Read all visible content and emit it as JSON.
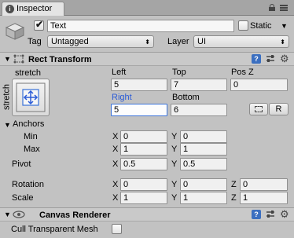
{
  "tab": {
    "label": "Inspector",
    "icon": "info-icon"
  },
  "object": {
    "name": "Text",
    "active": true,
    "static_label": "Static",
    "static_checked": false,
    "tag_label": "Tag",
    "tag_value": "Untagged",
    "layer_label": "Layer",
    "layer_value": "UI"
  },
  "rect_transform": {
    "title": "Rect Transform",
    "anchor_preset_label": "stretch",
    "anchor_preset_side_label": "stretch",
    "headers": {
      "left": "Left",
      "top": "Top",
      "posz": "Pos Z",
      "right": "Right",
      "bottom": "Bottom"
    },
    "values": {
      "left": "5",
      "top": "7",
      "posz": "0",
      "right": "5",
      "bottom": "6"
    },
    "blueprint_button": "",
    "raw_button": "R",
    "anchors_label": "Anchors",
    "min_label": "Min",
    "max_label": "Max",
    "anchors": {
      "min_x": "0",
      "min_y": "0",
      "max_x": "1",
      "max_y": "1"
    },
    "pivot_label": "Pivot",
    "pivot": {
      "x": "0.5",
      "y": "0.5"
    },
    "rotation_label": "Rotation",
    "rotation": {
      "x": "0",
      "y": "0",
      "z": "0"
    },
    "scale_label": "Scale",
    "scale": {
      "x": "1",
      "y": "1",
      "z": "1"
    },
    "axis": {
      "x": "X",
      "y": "Y",
      "z": "Z"
    }
  },
  "canvas_renderer": {
    "title": "Canvas Renderer",
    "cull_label": "Cull Transparent Mesh",
    "cull_checked": false
  },
  "colors": {
    "active_field_border": "#3a72d8",
    "active_label": "#2a5bd7",
    "tab_bg": "#e4e4e4"
  }
}
